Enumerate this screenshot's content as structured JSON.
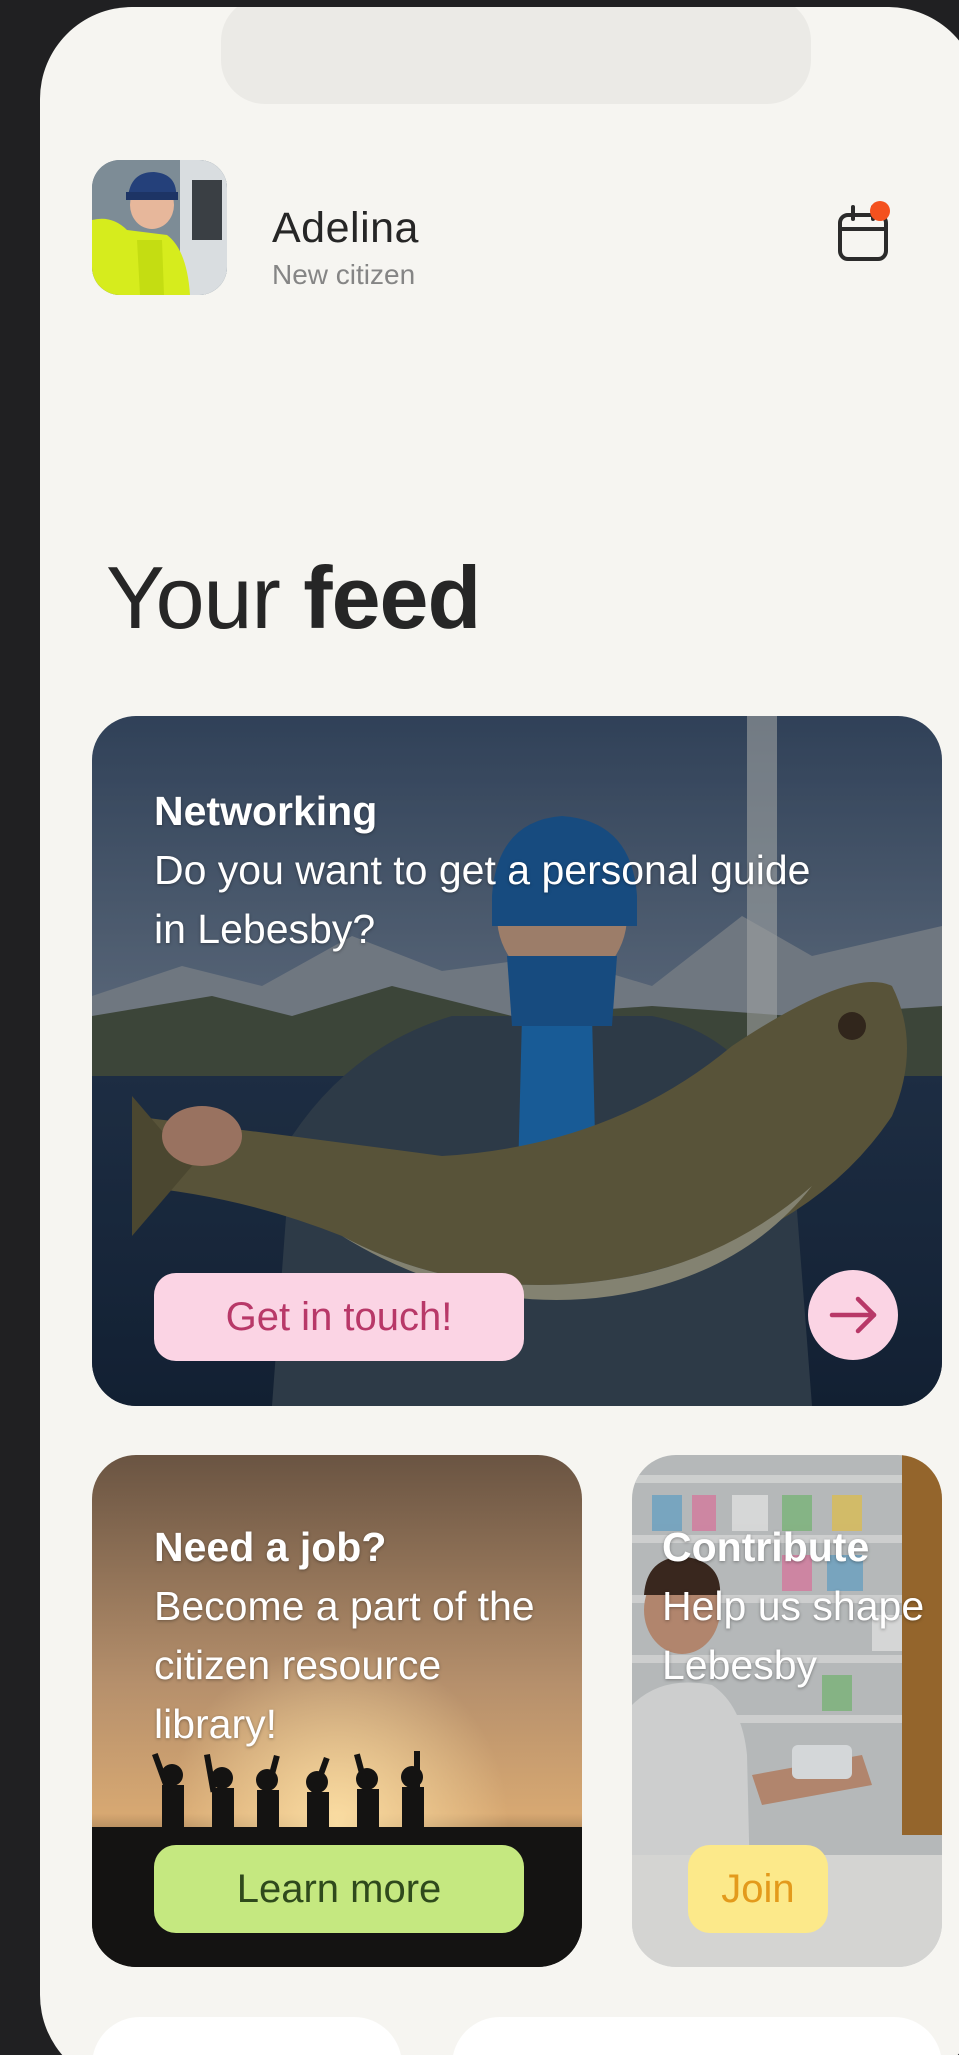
{
  "profile": {
    "name": "Adelina",
    "status": "New citizen",
    "avatar_icon": "user-photo"
  },
  "header": {
    "calendar_icon": "calendar-icon",
    "notification_color": "#f4511e"
  },
  "feed": {
    "title_light": "Your",
    "title_bold": "feed"
  },
  "cards": {
    "networking": {
      "category": "Networking",
      "description": "Do you want to get a personal guide in Lebesby?",
      "cta": "Get in touch!",
      "arrow_icon": "arrow-right-icon"
    },
    "job": {
      "category": "Need a job?",
      "description": "Become a part of the citizen resource library!",
      "cta": "Learn more"
    },
    "contribute": {
      "category": "Contribute",
      "description": "Help us shape Lebesby",
      "cta": "Join"
    }
  },
  "colors": {
    "background": "#f6f5f1",
    "pink_pill": "#fbd4e4",
    "green_pill": "#c5e880",
    "yellow_pill": "#fce98a"
  }
}
